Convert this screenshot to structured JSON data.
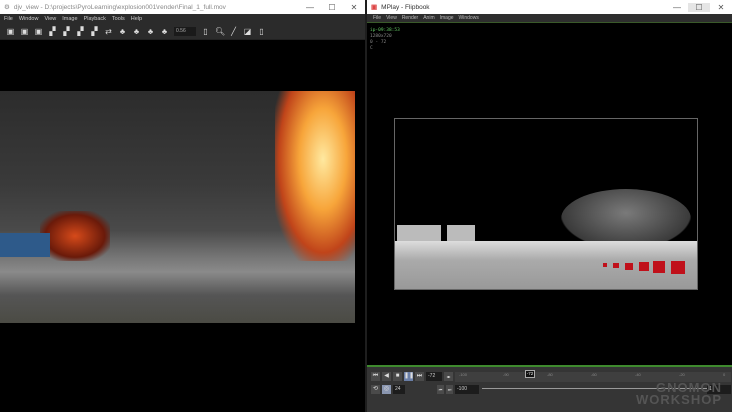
{
  "left_window": {
    "title": "djv_view - D:\\projects\\PyroLearning\\explosion001\\render\\Final_1_full.mov",
    "menu": [
      "File",
      "Window",
      "View",
      "Image",
      "Playback",
      "Tools",
      "Help"
    ],
    "zoom_value": "0.56",
    "controls": {
      "minimize": "—",
      "maximize": "☐",
      "close": "✕"
    }
  },
  "right_window": {
    "title": "MPlay - Flipbook",
    "menu": [
      "File",
      "View",
      "Render",
      "Anim",
      "Image",
      "Windows"
    ],
    "info": {
      "time": "ip-09:38:53",
      "resolution": "1280x720",
      "range": "0 - 72",
      "channel": "C"
    },
    "controls": {
      "minimize": "—",
      "maximize": "☐",
      "close": "✕"
    },
    "playback": {
      "current_frame": "-72",
      "fps": "24",
      "range_start": "-100",
      "range_end": "1",
      "timeline_marker": "-72",
      "ticks": [
        "-100",
        "-90",
        "-80",
        "-60",
        "-40",
        "-20",
        "0"
      ]
    }
  },
  "watermark": {
    "line1": "GNOMON",
    "line2": "WORKSHOP"
  }
}
